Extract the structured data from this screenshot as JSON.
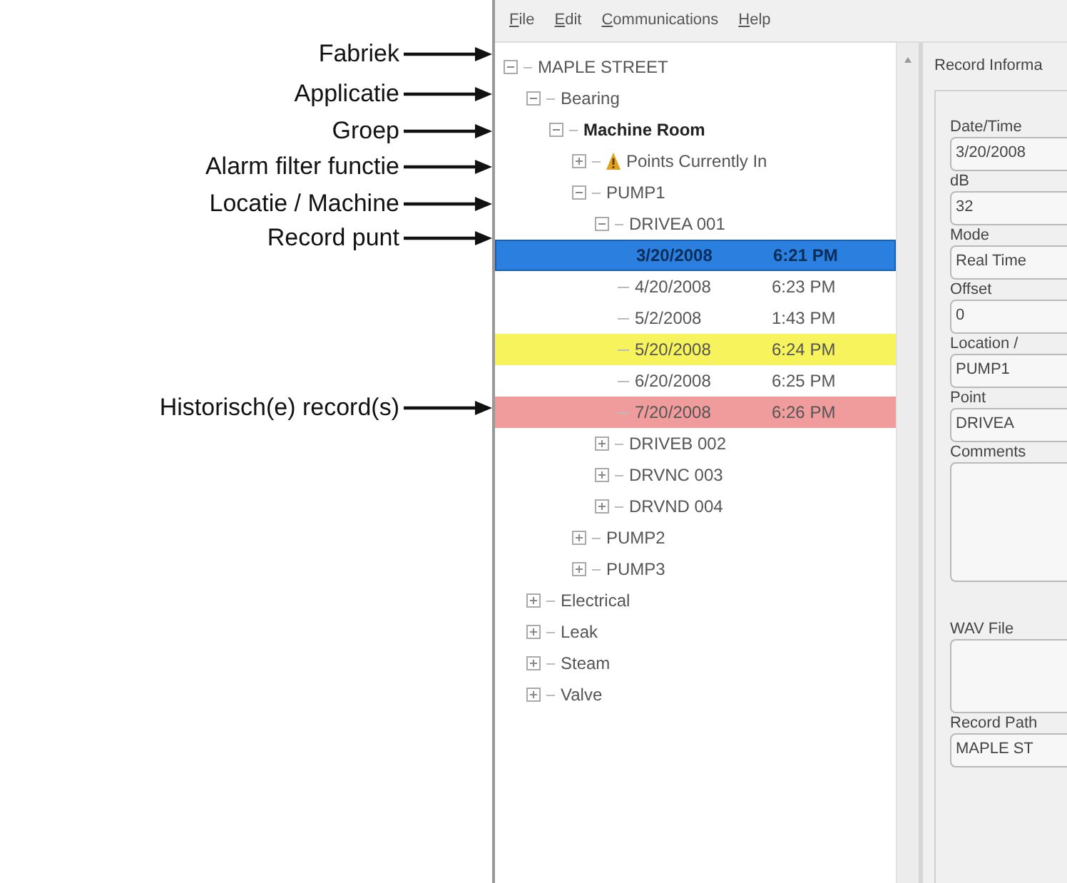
{
  "callouts": [
    {
      "text": "Fabriek"
    },
    {
      "text": "Applicatie"
    },
    {
      "text": "Groep"
    },
    {
      "text": "Alarm filter functie"
    },
    {
      "text": "Locatie / Machine"
    },
    {
      "text": "Record punt"
    },
    {
      "text": "Historisch(e) record(s)"
    }
  ],
  "menu": [
    "File",
    "Edit",
    "Communications",
    "Help"
  ],
  "tree": [
    {
      "kind": "folder",
      "label": "MAPLE STREET",
      "expanded": true,
      "bold": false,
      "children": [
        {
          "kind": "folder",
          "label": "Bearing",
          "expanded": true,
          "bold": false,
          "children": [
            {
              "kind": "folder",
              "label": "Machine Room",
              "expanded": true,
              "bold": true,
              "children": [
                {
                  "kind": "alarm_filter",
                  "label": "Points Currently In",
                  "expanded": false,
                  "bold": false
                },
                {
                  "kind": "folder",
                  "label": "PUMP1",
                  "expanded": true,
                  "bold": false,
                  "children": [
                    {
                      "kind": "folder",
                      "label": "DRIVEA 001",
                      "expanded": true,
                      "bold": false,
                      "children": [
                        {
                          "kind": "record",
                          "date": "3/20/2008",
                          "time": "6:21 PM",
                          "selected": true
                        },
                        {
                          "kind": "record",
                          "date": "4/20/2008",
                          "time": "6:23 PM",
                          "selected": false
                        },
                        {
                          "kind": "record",
                          "date": "5/2/2008",
                          "time": "1:43 PM",
                          "selected": false
                        },
                        {
                          "kind": "record",
                          "date": "5/20/2008",
                          "time": "6:24 PM",
                          "selected": false,
                          "color": "#f6f35c"
                        },
                        {
                          "kind": "record",
                          "date": "6/20/2008",
                          "time": "6:25 PM",
                          "selected": false
                        },
                        {
                          "kind": "record",
                          "date": "7/20/2008",
                          "time": "6:26 PM",
                          "selected": false,
                          "color": "#f09c9c"
                        }
                      ]
                    },
                    {
                      "kind": "folder",
                      "label": "DRIVEB 002",
                      "expanded": false,
                      "bold": false
                    },
                    {
                      "kind": "folder",
                      "label": "DRVNC 003",
                      "expanded": false,
                      "bold": false
                    },
                    {
                      "kind": "folder",
                      "label": "DRVND 004",
                      "expanded": false,
                      "bold": false
                    }
                  ]
                },
                {
                  "kind": "folder",
                  "label": "PUMP2",
                  "expanded": false,
                  "bold": false
                },
                {
                  "kind": "folder",
                  "label": "PUMP3",
                  "expanded": false,
                  "bold": false
                }
              ]
            }
          ]
        },
        {
          "kind": "folder",
          "label": "Electrical",
          "expanded": false,
          "bold": false
        },
        {
          "kind": "folder",
          "label": "Leak",
          "expanded": false,
          "bold": false
        },
        {
          "kind": "folder",
          "label": "Steam",
          "expanded": false,
          "bold": false
        },
        {
          "kind": "folder",
          "label": "Valve",
          "expanded": false,
          "bold": false
        }
      ]
    }
  ],
  "record_panel": {
    "title": "Record Informa",
    "fields": [
      {
        "kind": "text",
        "label": "Date/Time",
        "value": "3/20/2008"
      },
      {
        "kind": "text",
        "label": "dB",
        "value": "32"
      },
      {
        "kind": "text",
        "label": "Mode",
        "value": "Real Time"
      },
      {
        "kind": "text",
        "label": "Offset",
        "value": "0"
      },
      {
        "kind": "text",
        "label": "Location /",
        "value": "PUMP1"
      },
      {
        "kind": "text",
        "label": "Point",
        "value": "DRIVEA"
      },
      {
        "kind": "multiline",
        "label": "Comments"
      },
      {
        "kind": "file",
        "label": "WAV File"
      },
      {
        "kind": "text",
        "label": "Record Path",
        "value": "MAPLE ST"
      }
    ]
  }
}
